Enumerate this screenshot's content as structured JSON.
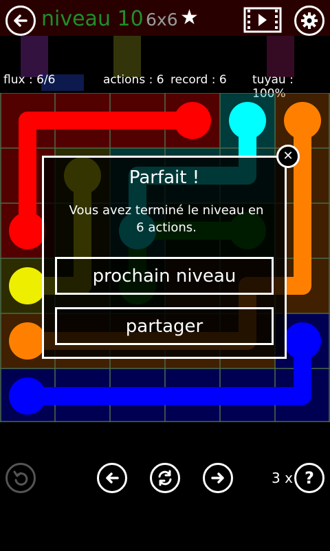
{
  "header": {
    "level": "niveau 10",
    "size": "6x6",
    "star": "★"
  },
  "stats": {
    "flows": "flux : 6/6",
    "moves": "actions : 6",
    "record": "record : 6",
    "pipe": "tuyau : 100%"
  },
  "dialog": {
    "title": "Parfait !",
    "message_line1": "Vous avez terminé le niveau en",
    "message_line2": "6 actions.",
    "next_button": "prochain niveau",
    "share_button": "partager",
    "close": "✕"
  },
  "bottom": {
    "hints": "3 x",
    "help": "?"
  },
  "colors": {
    "red": "#ff0000",
    "cyan": "#00ffff",
    "orange": "#ff8000",
    "yellow": "#eeee00",
    "blue": "#0000ff",
    "green": "#008000",
    "teal": "#2a8c96",
    "title_green": "#1f8f2a"
  },
  "grid": {
    "rows": 6,
    "cols": 6
  }
}
